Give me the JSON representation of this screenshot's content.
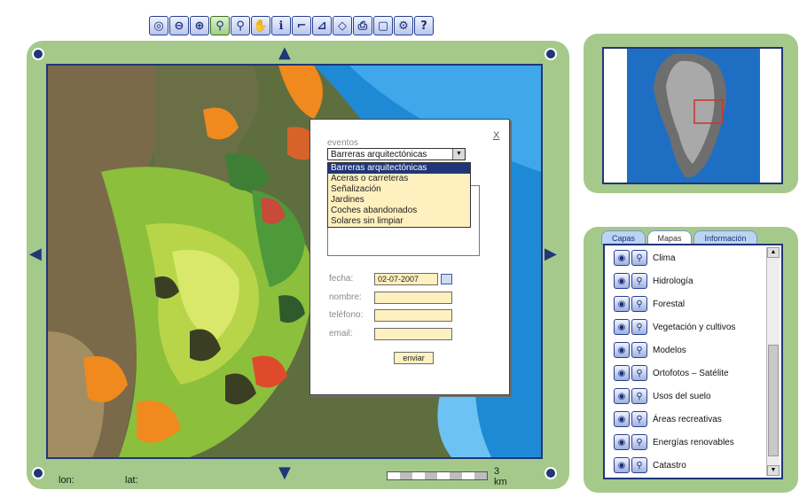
{
  "toolbar": {
    "buttons": [
      {
        "name": "full-extent-icon",
        "glyph": "◎"
      },
      {
        "name": "zoom-previous-icon",
        "glyph": "⊖"
      },
      {
        "name": "zoom-next-icon",
        "glyph": "⊕"
      },
      {
        "name": "zoom-in-icon",
        "glyph": "⚲"
      },
      {
        "name": "zoom-out-icon",
        "glyph": "⚲"
      },
      {
        "name": "pan-hand-icon",
        "glyph": "✋"
      },
      {
        "name": "info-icon",
        "glyph": "ℹ"
      },
      {
        "name": "measure-icon",
        "glyph": "⌐"
      },
      {
        "name": "area-icon",
        "glyph": "⊿"
      },
      {
        "name": "eraser-icon",
        "glyph": "◇"
      },
      {
        "name": "print-icon",
        "glyph": "⎙"
      },
      {
        "name": "window-icon",
        "glyph": "▢"
      },
      {
        "name": "settings-icon",
        "glyph": "⚙"
      },
      {
        "name": "help-icon",
        "glyph": "?"
      }
    ]
  },
  "map": {
    "lon_label": "lon:",
    "lat_label": "lat:",
    "scale_value": "3",
    "scale_unit": "km"
  },
  "form": {
    "close": "X",
    "events_label": "eventos",
    "selected_event": "Barreras arquitectónicas",
    "event_options": [
      "Barreras arquitectónicas",
      "Aceras o carreteras",
      "Señalización",
      "Jardines",
      "Coches abandonados",
      "Solares sin limpiar"
    ],
    "date_label": "fecha:",
    "date_value": "02-07-2007",
    "name_label": "nombre:",
    "phone_label": "teléfono:",
    "email_label": "email:",
    "send_label": "enviar"
  },
  "layers_panel": {
    "tabs": [
      "Capas",
      "Mapas",
      "Información"
    ],
    "active_tab": "Mapas",
    "items": [
      "Clima",
      "Hidrología",
      "Forestal",
      "Vegetación y cultivos",
      "Modelos",
      "Ortofotos – Satélite",
      "Usos del suelo",
      "Áreas recreativas",
      "Energías renovables",
      "Catastro"
    ]
  },
  "colors": {
    "frame_green": "#a5c98a",
    "accent_navy": "#1f3679",
    "field_yellow": "#fff1bf",
    "sea_blue": "#1e8ad6"
  }
}
